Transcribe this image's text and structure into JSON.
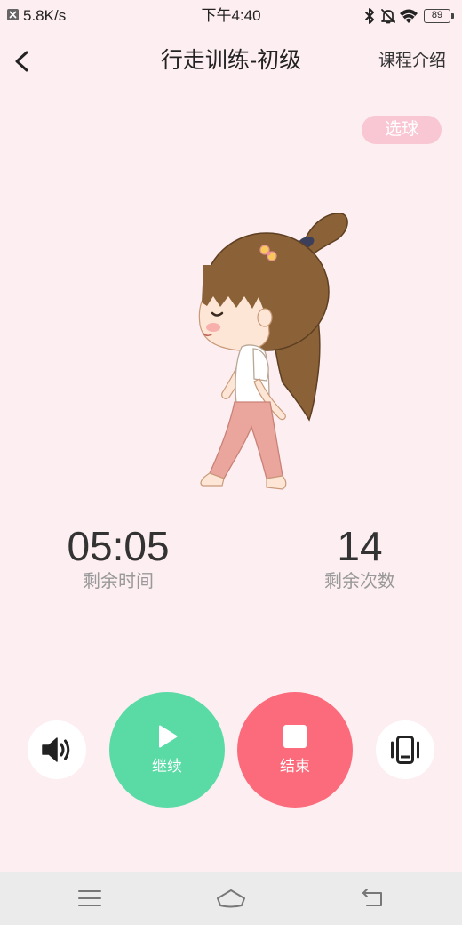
{
  "status_bar": {
    "notification_icon": "close-box-icon",
    "network_speed": "5.8K/s",
    "time": "下午4:40",
    "icons": [
      "bluetooth-icon",
      "bell-off-icon",
      "wifi-icon",
      "battery-icon"
    ],
    "battery": "89"
  },
  "header": {
    "back_icon": "chevron-left-icon",
    "title": "行走训练-初级",
    "course_intro": "课程介绍"
  },
  "select_ball": "选球",
  "stats": {
    "remaining_time": {
      "value": "05:05",
      "label": "剩余时间"
    },
    "remaining_count": {
      "value": "14",
      "label": "剩余次数"
    }
  },
  "controls": {
    "sound": {
      "icon": "speaker-icon"
    },
    "continue": {
      "icon": "play-icon",
      "label": "继续"
    },
    "end": {
      "icon": "stop-icon",
      "label": "结束"
    },
    "vibrate": {
      "icon": "vibrate-phone-icon"
    }
  },
  "nav_bar": {
    "icons": [
      "menu-icon",
      "home-icon",
      "back-icon"
    ]
  },
  "colors": {
    "background": "#fdeef1",
    "select_ball": "#f9c6d3",
    "continue": "#5adba6",
    "end": "#fb6b7b",
    "nav_bar": "#ebebeb",
    "text_primary": "#333333",
    "text_secondary": "#999999"
  }
}
